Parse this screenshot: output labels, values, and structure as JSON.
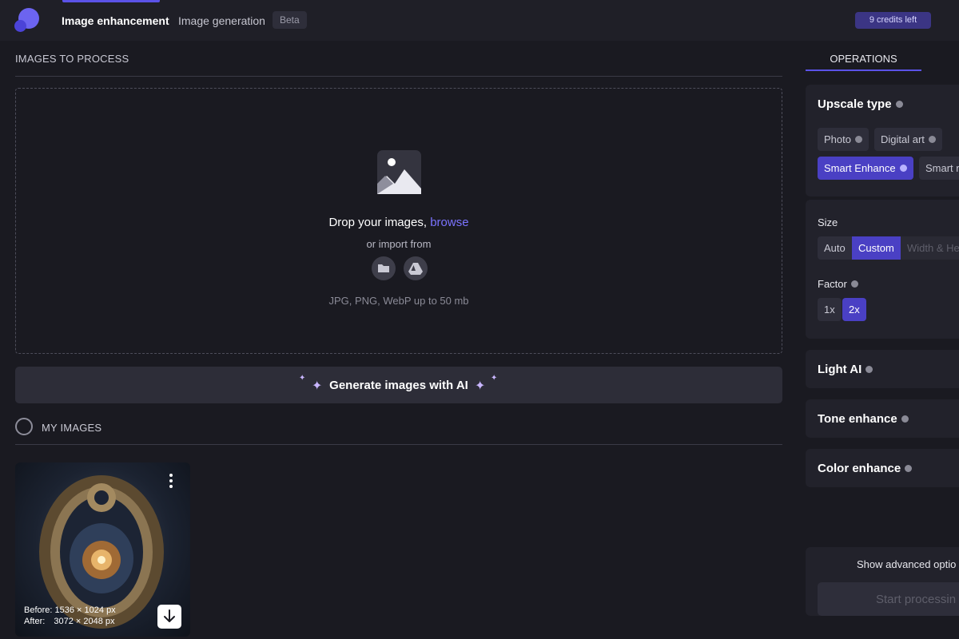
{
  "header": {
    "tabs": [
      {
        "label": "Image enhancement",
        "active": true
      },
      {
        "label": "Image generation",
        "active": false
      }
    ],
    "beta_badge": "Beta",
    "credits": "9 credits left"
  },
  "images_section": {
    "title": "IMAGES TO PROCESS",
    "drop_text": "Drop your images,",
    "browse_link": "browse",
    "import_text": "or import from",
    "formats": "JPG, PNG, WebP up to 50 mb",
    "import_sources": [
      "folder-icon",
      "google-drive-icon"
    ]
  },
  "generate_button": {
    "label": "Generate images with AI"
  },
  "my_images": {
    "title": "MY IMAGES",
    "items": [
      {
        "before_label": "Before:",
        "before_value": "1536 × 1024 px",
        "after_label": "After:",
        "after_value": "3072 × 2048 px"
      }
    ]
  },
  "operations": {
    "tab_label": "OPERATIONS",
    "upscale": {
      "title": "Upscale type",
      "options": [
        {
          "label": "Photo",
          "selected": false
        },
        {
          "label": "Digital art",
          "selected": false
        },
        {
          "label": "Smart Enhance",
          "selected": true
        },
        {
          "label": "Smart r",
          "selected": false
        }
      ]
    },
    "size": {
      "title": "Size",
      "options": [
        {
          "label": "Auto",
          "selected": false
        },
        {
          "label": "Custom",
          "selected": true
        },
        {
          "label": "Width & He",
          "selected": false
        }
      ]
    },
    "factor": {
      "title": "Factor",
      "options": [
        {
          "label": "1x",
          "selected": false
        },
        {
          "label": "2x",
          "selected": true
        }
      ]
    },
    "light_ai": {
      "title": "Light AI"
    },
    "tone_enhance": {
      "title": "Tone enhance"
    },
    "color_enhance": {
      "title": "Color enhance"
    },
    "advanced_label": "Show advanced optio",
    "start_label": "Start processin"
  },
  "colors": {
    "accent": "#5b52e8",
    "selected_chip": "#4a40c4",
    "link": "#7b73ff",
    "background": "#1a1a21"
  }
}
